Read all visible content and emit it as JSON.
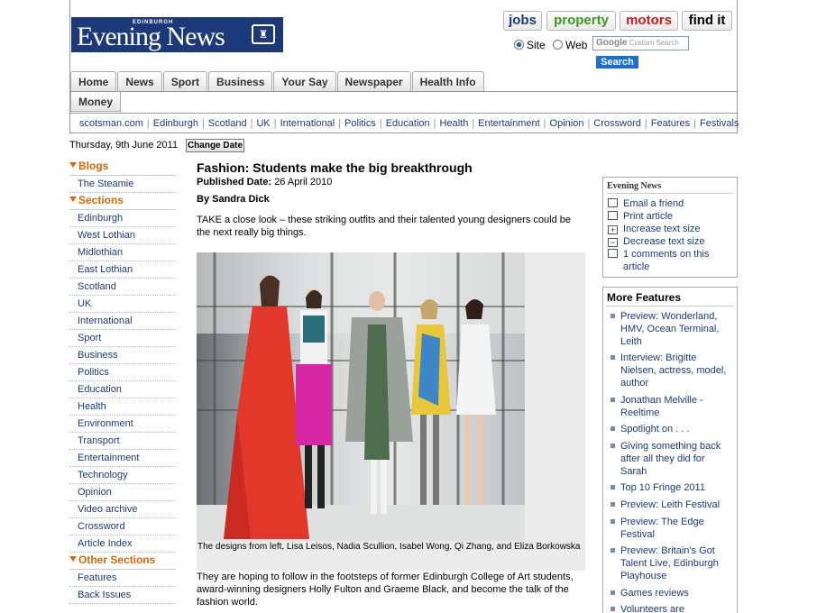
{
  "logo": {
    "small": "EDINBURGH",
    "name": "Evening News"
  },
  "sites": {
    "jobs": "jobs",
    "property": "property",
    "motors": "motors",
    "find": "find it"
  },
  "search": {
    "site_label": "Site",
    "web_label": "Web",
    "placeholder": "Custom Search",
    "google": "Google",
    "button": "Search"
  },
  "tabs": [
    "Home",
    "News",
    "Sport",
    "Business",
    "Your Say",
    "Newspaper",
    "Health Info"
  ],
  "tab_money": "Money",
  "subnav": [
    "scotsman.com",
    "Edinburgh",
    "Scotland",
    "UK",
    "International",
    "Politics",
    "Education",
    "Health",
    "Entertainment",
    "Opinion",
    "Crossword",
    "Features",
    "Festivals"
  ],
  "date": "Thursday, 9th June 2011",
  "change_date": "Change Date",
  "leftnav": {
    "blogs_head": "Blogs",
    "blogs": [
      "The Steamie"
    ],
    "sections_head": "Sections",
    "sections": [
      "Edinburgh",
      "West Lothian",
      "Midlothian",
      "East Lothian",
      "Scotland",
      "UK",
      "International",
      "Sport",
      "Business",
      "Politics",
      "Education",
      "Health",
      "Environment",
      "Transport",
      "Entertainment",
      "Technology",
      "Opinion",
      "Video archive",
      "Crossword",
      "Article Index"
    ],
    "other_head": "Other Sections",
    "other": [
      "Features",
      "Back Issues"
    ]
  },
  "article": {
    "title": "Fashion: Students make the big breakthrough",
    "published_label": "Published Date:",
    "published_date": "26 April 2010",
    "author": "By Sandra Dick",
    "intro": "TAKE a close look – these striking outfits and their talented young designers could be the next really big things.",
    "caption": "The designs from left, Lisa Leisos, Nadia Scullion, Isabel Wong, Qi Zhang, and Eliza Borkowska",
    "body": "They are hoping to follow in the footsteps of former Edinburgh College of Art students, award-winning designers Holly Fulton and Graeme Black, and become the talk of the fashion world."
  },
  "tools": {
    "brand": "Evening News",
    "items": [
      "Email a friend",
      "Print article",
      "Increase text size",
      "Decrease text size",
      "1 comments on this",
      "article"
    ]
  },
  "more": {
    "head": "More Features",
    "items": [
      [
        "Preview: Wonderland,",
        "HMV, Ocean Terminal,",
        "Leith"
      ],
      [
        "Interview: Brigitte",
        "Nielsen, actress, model,",
        "author"
      ],
      [
        "Jonathan Melville -",
        "Reeltime"
      ],
      [
        "Spotlight on . . ."
      ],
      [
        "Giving something back",
        "after all they did for",
        "Sarah"
      ],
      [
        "Top 10 Fringe 2011"
      ],
      [
        "Preview: Leith Festival"
      ],
      [
        "Preview: The Edge",
        "Festival"
      ],
      [
        "Preview: Britain's Got",
        "Talent Live, Edinburgh",
        "Playhouse"
      ],
      [
        "Games reviews"
      ],
      [
        "Volunteers are"
      ]
    ]
  }
}
